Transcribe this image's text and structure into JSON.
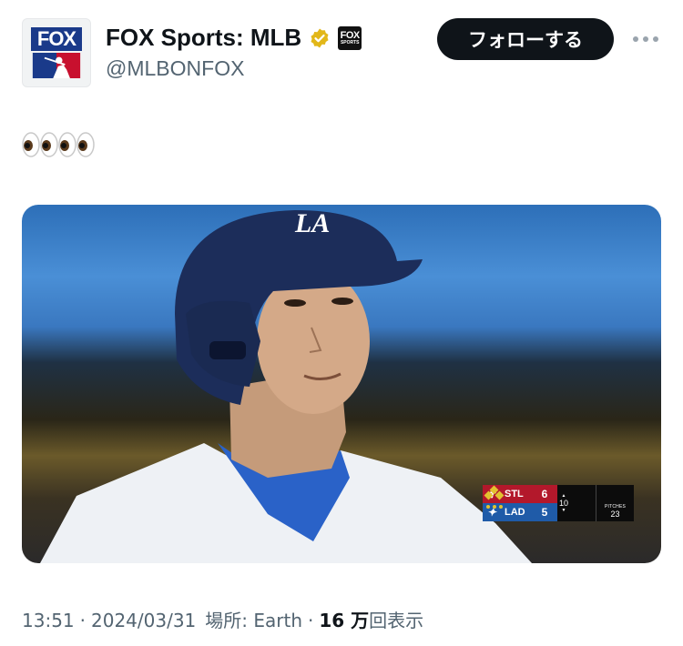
{
  "author": {
    "display_name": "FOX Sports: MLB",
    "handle": "@MLBONFOX",
    "avatar_text": "FOX",
    "org_badge_text": "FOX",
    "org_badge_subtext": "SPORTS"
  },
  "follow_button": {
    "label": "フォローする"
  },
  "tweet": {
    "text_emoji": "👀👀"
  },
  "scorebug": {
    "away": {
      "abbr": "STL",
      "score": "6"
    },
    "home": {
      "abbr": "LAD",
      "score": "5"
    },
    "inning": "10",
    "pitches_label": "PITCHES",
    "pitches": "23"
  },
  "meta": {
    "time": "13:51",
    "date": "2024/03/31",
    "location_label": "場所: Earth",
    "views_number": "16 万",
    "views_suffix": "回表示"
  },
  "colors": {
    "text_primary": "#0f1419",
    "text_secondary": "#536471",
    "button_bg": "#0f1419",
    "verified_gold": "#e2b719",
    "stl_red": "#b3182b",
    "lad_blue": "#1f5ba8"
  }
}
